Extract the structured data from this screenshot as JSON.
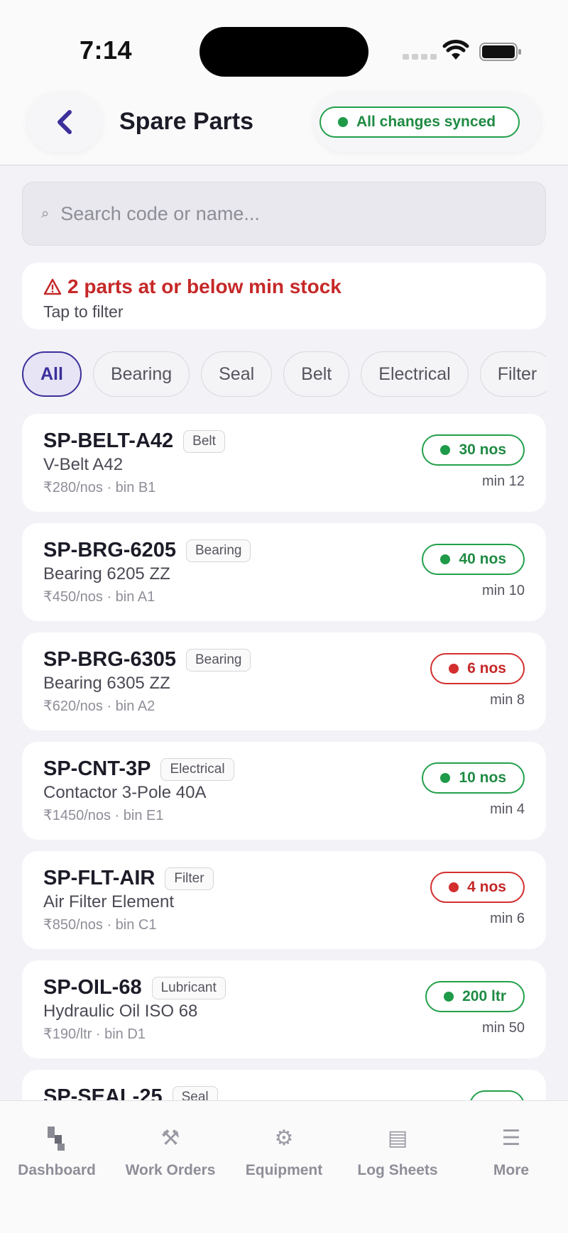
{
  "status_bar": {
    "time": "7:14"
  },
  "header": {
    "title": "Spare Parts",
    "sync_status": "All changes synced"
  },
  "search": {
    "placeholder": "Search code or name...",
    "value": ""
  },
  "alert": {
    "title": "2 parts at or below min stock",
    "subtitle": "Tap to filter"
  },
  "filters": [
    "All",
    "Bearing",
    "Seal",
    "Belt",
    "Electrical",
    "Filter"
  ],
  "active_filter": "All",
  "parts": [
    {
      "code": "SP-BELT-A42",
      "category": "Belt",
      "name": "V-Belt A42",
      "meta": "₹280/nos · bin B1",
      "stock": "30 nos",
      "min": "min 12",
      "low": false
    },
    {
      "code": "SP-BRG-6205",
      "category": "Bearing",
      "name": "Bearing 6205 ZZ",
      "meta": "₹450/nos · bin A1",
      "stock": "40 nos",
      "min": "min 10",
      "low": false
    },
    {
      "code": "SP-BRG-6305",
      "category": "Bearing",
      "name": "Bearing 6305 ZZ",
      "meta": "₹620/nos · bin A2",
      "stock": "6 nos",
      "min": "min 8",
      "low": true
    },
    {
      "code": "SP-CNT-3P",
      "category": "Electrical",
      "name": "Contactor 3-Pole 40A",
      "meta": "₹1450/nos · bin E1",
      "stock": "10 nos",
      "min": "min 4",
      "low": false
    },
    {
      "code": "SP-FLT-AIR",
      "category": "Filter",
      "name": "Air Filter Element",
      "meta": "₹850/nos · bin C1",
      "stock": "4 nos",
      "min": "min 6",
      "low": true
    },
    {
      "code": "SP-OIL-68",
      "category": "Lubricant",
      "name": "Hydraulic Oil ISO 68",
      "meta": "₹190/ltr · bin D1",
      "stock": "200 ltr",
      "min": "min 50",
      "low": false
    },
    {
      "code": "SP-SEAL-25",
      "category": "Seal",
      "name": "",
      "meta": "",
      "stock": "",
      "min": "",
      "low": false
    }
  ],
  "tabbar": [
    {
      "label": "Dashboard",
      "icon": "dashboard-icon"
    },
    {
      "label": "Work Orders",
      "icon": "tools-icon"
    },
    {
      "label": "Equipment",
      "icon": "gear-icon"
    },
    {
      "label": "Log Sheets",
      "icon": "log-sheet-icon"
    },
    {
      "label": "More",
      "icon": "menu-icon"
    }
  ],
  "colors": {
    "accent": "#3b2f9a",
    "ok": "#1f8a43",
    "low": "#c62828"
  }
}
